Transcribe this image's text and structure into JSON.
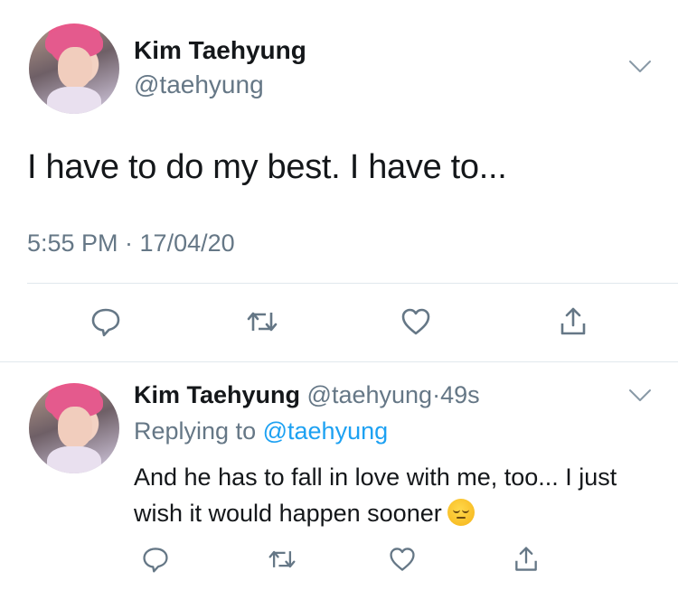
{
  "main_tweet": {
    "author_name": "Kim Taehyung",
    "author_handle": "@taehyung",
    "text": "I have to do my best. I have to...",
    "timestamp": "5:55 PM · 17/04/20",
    "actions": [
      "reply-icon",
      "retweet-icon",
      "like-icon",
      "share-icon"
    ]
  },
  "reply_tweet": {
    "author_name": "Kim Taehyung",
    "author_handle": "@taehyung",
    "separator": "·",
    "age": "49s",
    "replying_prefix": "Replying to",
    "replying_to": "@taehyung",
    "text": "And he has to fall in love with me, too... I just wish it would happen sooner",
    "emoji": "pensive-face-emoji",
    "actions": [
      "reply-icon",
      "retweet-icon",
      "like-icon",
      "share-icon"
    ]
  },
  "colors": {
    "text_primary": "#14171a",
    "text_secondary": "#657786",
    "link": "#1da1f2",
    "divider": "#e1e8ed",
    "icon": "#657786"
  }
}
